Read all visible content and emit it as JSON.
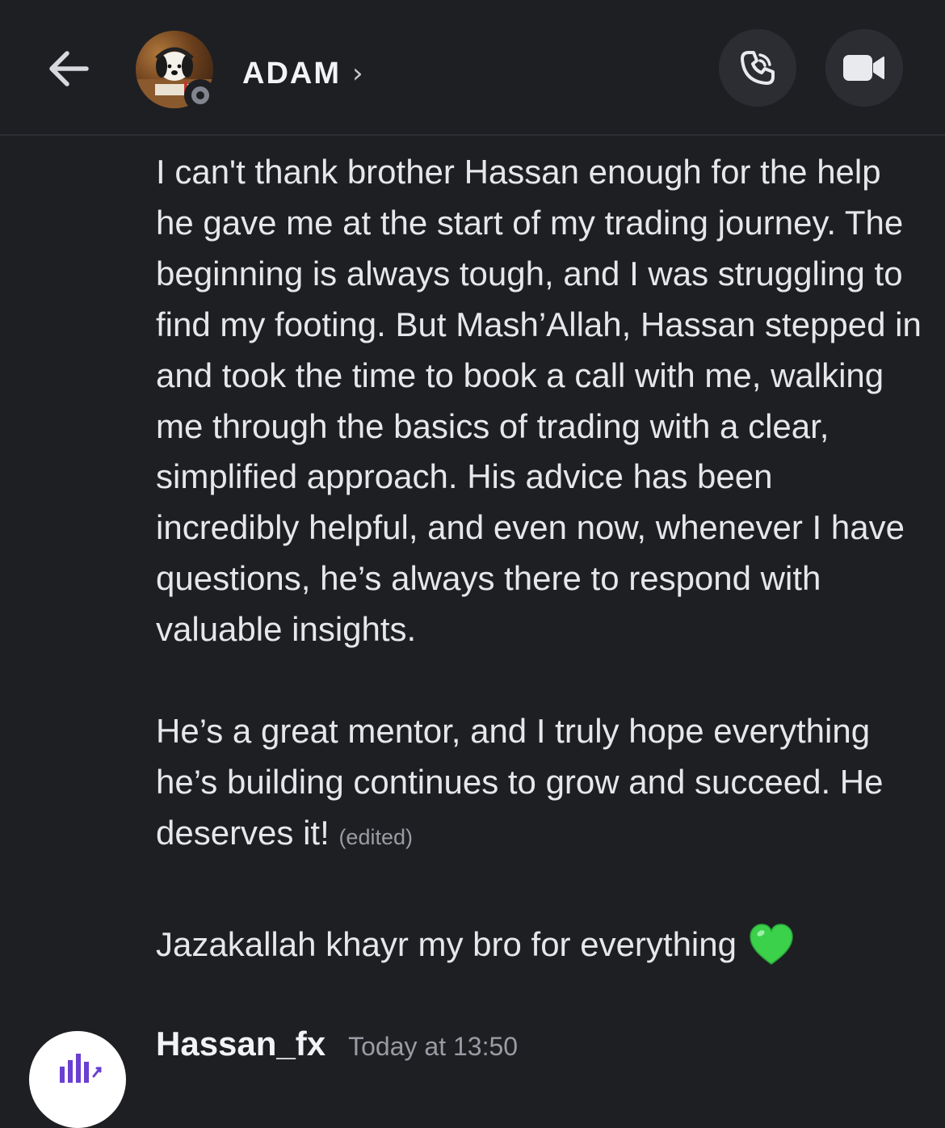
{
  "header": {
    "back_icon": "arrow-left-icon",
    "contact_name": "ADAM",
    "chevron": "›",
    "status": "offline",
    "call_icon": "phone-icon",
    "video_icon": "video-camera-icon"
  },
  "messages": [
    {
      "paragraph_1": "I can't thank brother Hassan enough for the help he gave me at the start of my trading journey. The beginning is always tough, and I was struggling to find my footing. But Mash’Allah, Hassan stepped in and took the time to book a call with me, walking me through the basics of trading with a clear, simplified approach. His advice has been incredibly helpful, and even now, whenever I have questions, he’s always there to respond with valuable insights.",
      "paragraph_2": "He’s a great mentor, and I truly hope everything he’s building continues to grow and succeed. He deserves it!",
      "edited_label": "(edited)"
    },
    {
      "text": "Jazakallah khayr my bro for everything",
      "emoji": "green-heart-icon"
    }
  ],
  "next_message": {
    "author": "Hassan_fx",
    "timestamp": "Today at 13:50"
  },
  "colors": {
    "background": "#1e1f23",
    "text": "#e6e7ea",
    "muted": "#9a9ca4",
    "button_bg": "#2b2d33",
    "heart": "#3bd14a",
    "logo_purple": "#6a3fd1"
  }
}
